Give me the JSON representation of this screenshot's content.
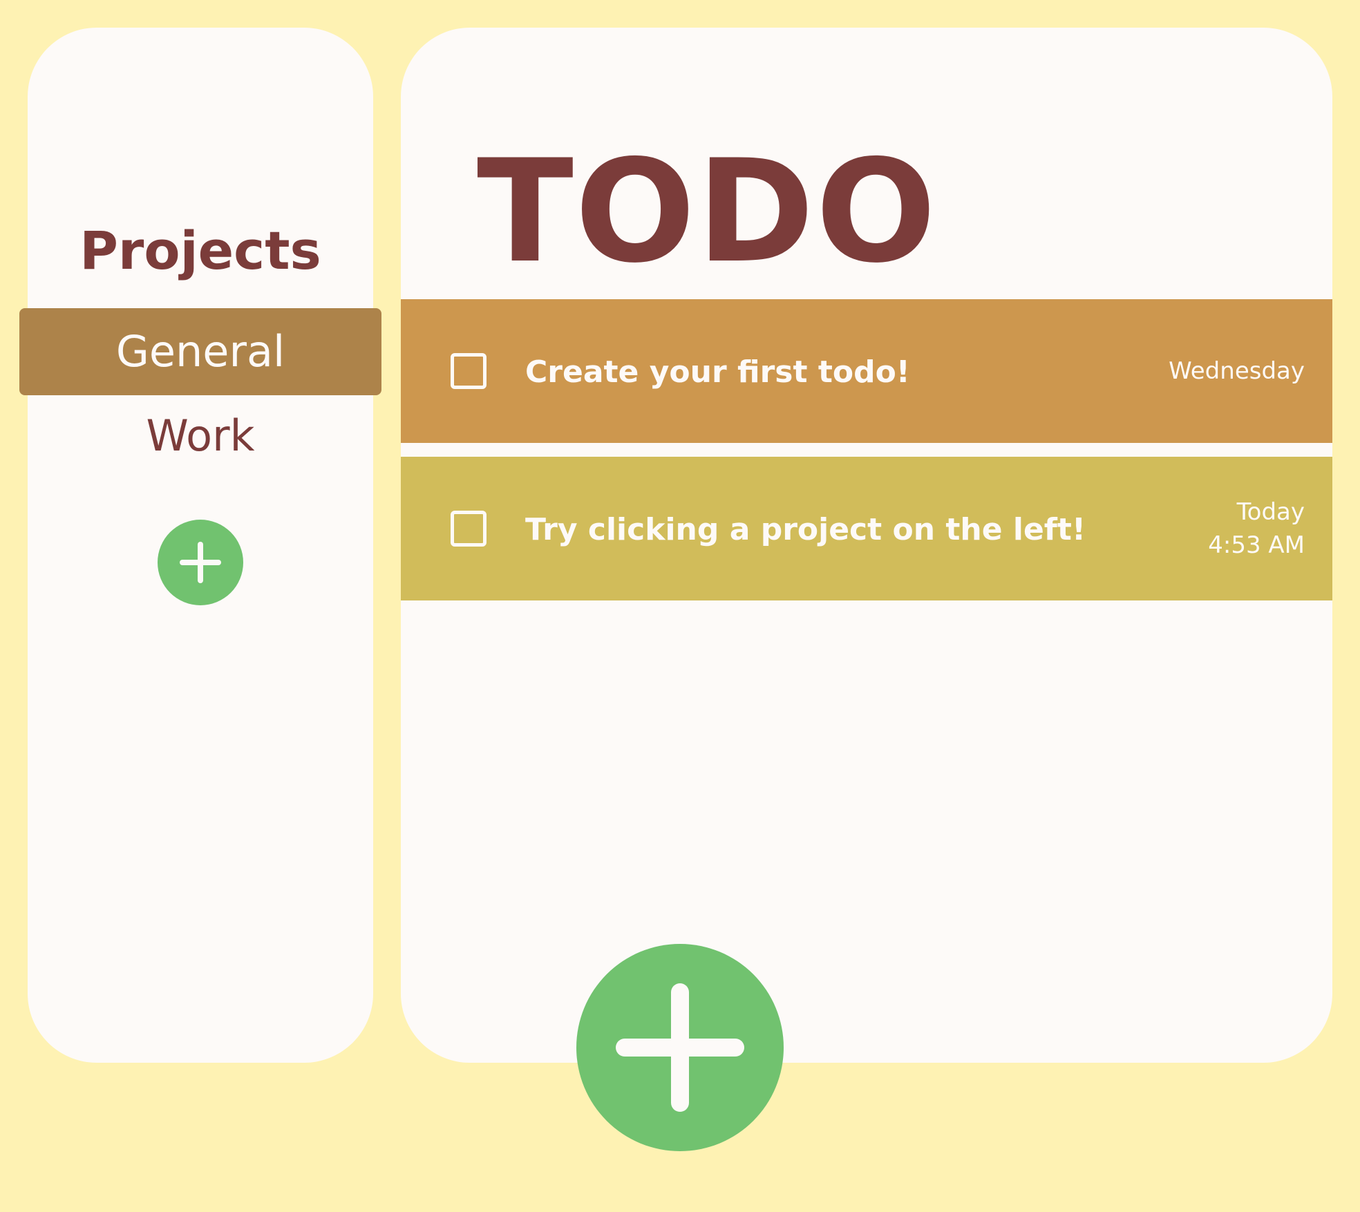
{
  "sidebar": {
    "title": "Projects",
    "projects": [
      {
        "label": "General",
        "active": true
      },
      {
        "label": "Work",
        "active": false
      }
    ],
    "add_icon": "plus-icon"
  },
  "main": {
    "title": "TODO",
    "todos": [
      {
        "text": "Create your first todo!",
        "date_line1": "Wednesday",
        "date_line2": "",
        "color": "#cd974e",
        "checked": false
      },
      {
        "text": "Try clicking a project on the left!",
        "date_line1": "Today",
        "date_line2": "4:53 AM",
        "color": "#d1bc5a",
        "checked": false
      }
    ],
    "add_icon": "plus-icon"
  },
  "colors": {
    "background": "#fef2b3",
    "panel": "#fdfaf8",
    "accent_text": "#7b3c3a",
    "active_project": "#ad834a",
    "add_button": "#71c26f"
  }
}
